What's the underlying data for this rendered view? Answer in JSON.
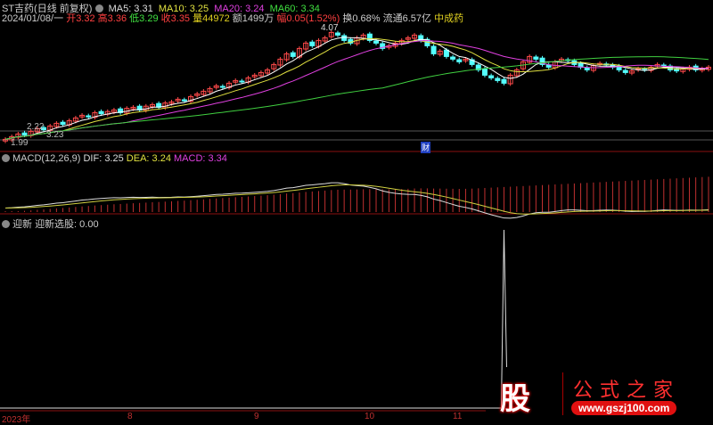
{
  "header": {
    "title": "ST吉药(日线 前复权)",
    "ma5": "MA5: 3.31",
    "ma10": "MA10: 3.25",
    "ma20": "MA20: 3.24",
    "ma60": "MA60: 3.34",
    "date": "2024/01/08/一",
    "open_l": "开",
    "open": "3.32",
    "high_l": "高",
    "high": "3.36",
    "low_l": "低",
    "low": "3.29",
    "close_l": "收",
    "close": "3.35",
    "vol_l": "量",
    "vol": "44972",
    "amt": "额1499万",
    "chg_l": "幅",
    "chg": "0.05(1.52%)",
    "turn": "换0.68%",
    "float": "流通6.57亿",
    "sector": "中成药"
  },
  "price_labels": {
    "high": "4.07",
    "mid": "3.23",
    "mid2": "2.22",
    "low": "1.99"
  },
  "marker": "财",
  "macd": {
    "title": "MACD(12,26,9)",
    "dif": "DIF: 3.25",
    "dea": "DEA: 3.24",
    "macd": "MACD: 3.34"
  },
  "indicator": {
    "title": "迎新",
    "label": "迎新选股: 0.00"
  },
  "xaxis": [
    "2023年",
    "8",
    "9",
    "10",
    "11"
  ],
  "logo": {
    "char": "股",
    "name": "公式之家",
    "url": "www.gszj100.com"
  },
  "colors": {
    "up": "#ff4a4a",
    "down": "#54ffff",
    "ma5": "#ffffff",
    "ma10": "#e0e040",
    "ma20": "#e040e0",
    "ma60": "#40d040"
  },
  "chart_data": {
    "type": "candlestick",
    "closes": [
      2.0,
      2.05,
      2.1,
      2.08,
      2.15,
      2.2,
      2.18,
      2.25,
      2.3,
      2.28,
      2.35,
      2.4,
      2.45,
      2.42,
      2.5,
      2.48,
      2.52,
      2.55,
      2.5,
      2.58,
      2.6,
      2.55,
      2.62,
      2.65,
      2.6,
      2.68,
      2.7,
      2.75,
      2.72,
      2.8,
      2.85,
      2.9,
      2.95,
      3.0,
      2.98,
      3.05,
      3.1,
      3.08,
      3.15,
      3.2,
      3.25,
      3.3,
      3.4,
      3.5,
      3.6,
      3.55,
      3.7,
      3.8,
      3.75,
      3.85,
      3.9,
      4.0,
      3.95,
      3.85,
      3.8,
      3.9,
      3.95,
      3.85,
      3.8,
      3.7,
      3.75,
      3.8,
      3.85,
      3.9,
      3.95,
      3.85,
      3.75,
      3.6,
      3.65,
      3.55,
      3.5,
      3.45,
      3.5,
      3.4,
      3.3,
      3.2,
      3.15,
      3.1,
      3.05,
      3.2,
      3.3,
      3.45,
      3.55,
      3.5,
      3.4,
      3.35,
      3.45,
      3.5,
      3.48,
      3.4,
      3.35,
      3.3,
      3.38,
      3.42,
      3.4,
      3.35,
      3.3,
      3.25,
      3.28,
      3.32,
      3.3,
      3.35,
      3.4,
      3.38,
      3.3,
      3.28,
      3.32,
      3.35,
      3.3,
      3.32,
      3.35
    ],
    "ylim": [
      1.99,
      4.07
    ],
    "signal_index": 78
  }
}
